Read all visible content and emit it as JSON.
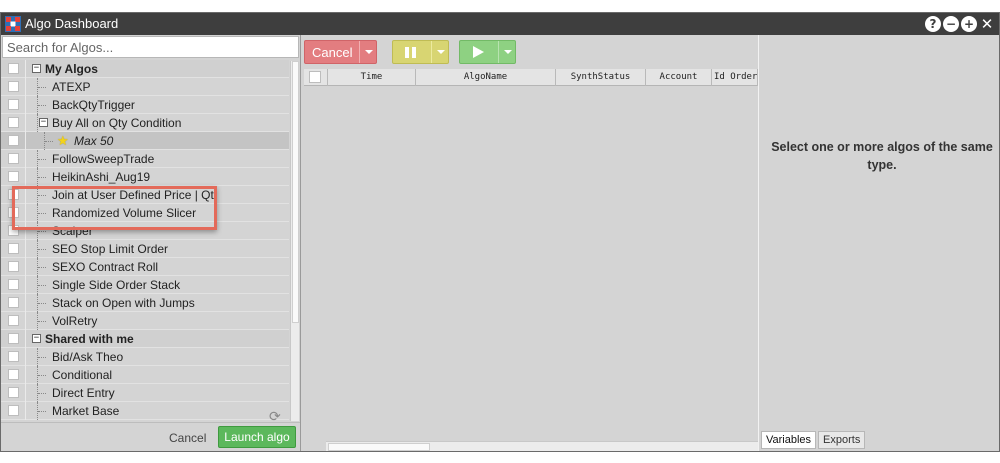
{
  "window": {
    "title": "Algo Dashboard"
  },
  "search": {
    "placeholder": "Search for Algos..."
  },
  "tree": {
    "my_algos": {
      "label": "My Algos",
      "items": [
        "ATEXP",
        "BackQtyTrigger",
        "Buy All on Qty Condition",
        "Max 50",
        "FollowSweepTrade",
        "HeikinAshi_Aug19",
        "Join at User Defined Price | Qt",
        "Randomized Volume Slicer",
        "Scalper",
        "SEO Stop Limit Order",
        "SEXO Contract Roll",
        "Single Side Order Stack",
        "Stack on Open with Jumps",
        "VolRetry"
      ]
    },
    "shared": {
      "label": "Shared with me",
      "items": [
        "Bid/Ask Theo",
        "Conditional",
        "Direct Entry",
        "Market Base"
      ]
    }
  },
  "footer": {
    "cancel_label": "Cancel",
    "launch_label": "Launch algo"
  },
  "toolbar": {
    "cancel_label": "Cancel"
  },
  "grid": {
    "columns": [
      "Time",
      "AlgoName",
      "SynthStatus",
      "Account",
      "Id Order"
    ]
  },
  "right": {
    "message": "Select one or more algos of the same type.",
    "tabs": [
      "Variables",
      "Exports"
    ]
  },
  "colors": {
    "titlebar": "#3e3e3e",
    "launch": "#5cb85c",
    "cancel_btn": "#e37d80",
    "pause_btn": "#d8d572",
    "play_btn": "#8ed182",
    "callout": "#e36a5a"
  }
}
